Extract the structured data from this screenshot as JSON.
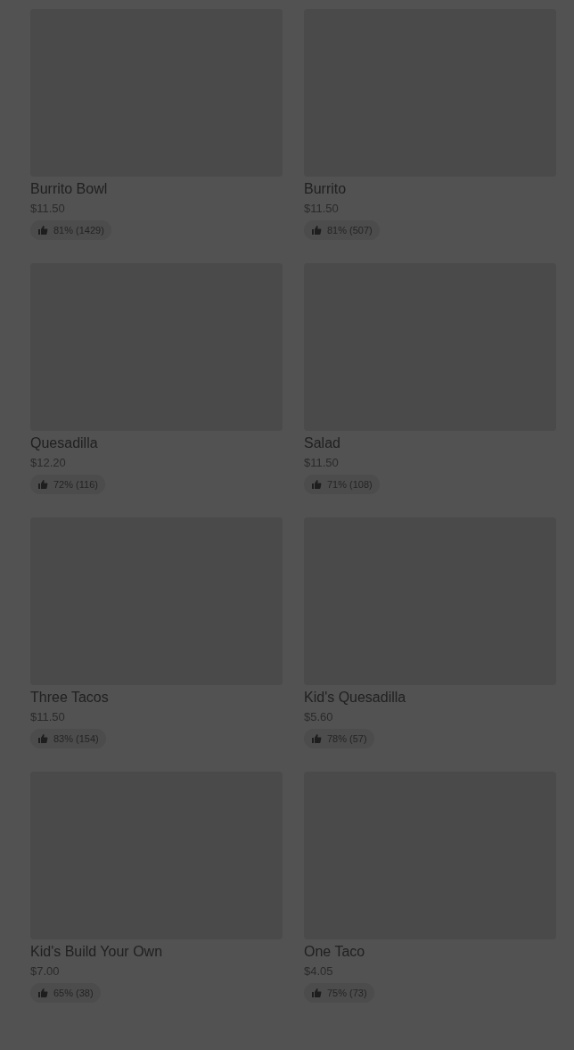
{
  "items": [
    {
      "name": "Burrito Bowl",
      "price": "$11.50",
      "rating": "81% (1429)"
    },
    {
      "name": "Burrito",
      "price": "$11.50",
      "rating": "81% (507)"
    },
    {
      "name": "Quesadilla",
      "price": "$12.20",
      "rating": "72% (116)"
    },
    {
      "name": "Salad",
      "price": "$11.50",
      "rating": "71% (108)"
    },
    {
      "name": "Three Tacos",
      "price": "$11.50",
      "rating": "83% (154)"
    },
    {
      "name": "Kid's Quesadilla",
      "price": "$5.60",
      "rating": "78% (57)"
    },
    {
      "name": "Kid's Build Your Own",
      "price": "$7.00",
      "rating": "65% (38)"
    },
    {
      "name": "One Taco",
      "price": "$4.05",
      "rating": "75% (73)"
    }
  ]
}
